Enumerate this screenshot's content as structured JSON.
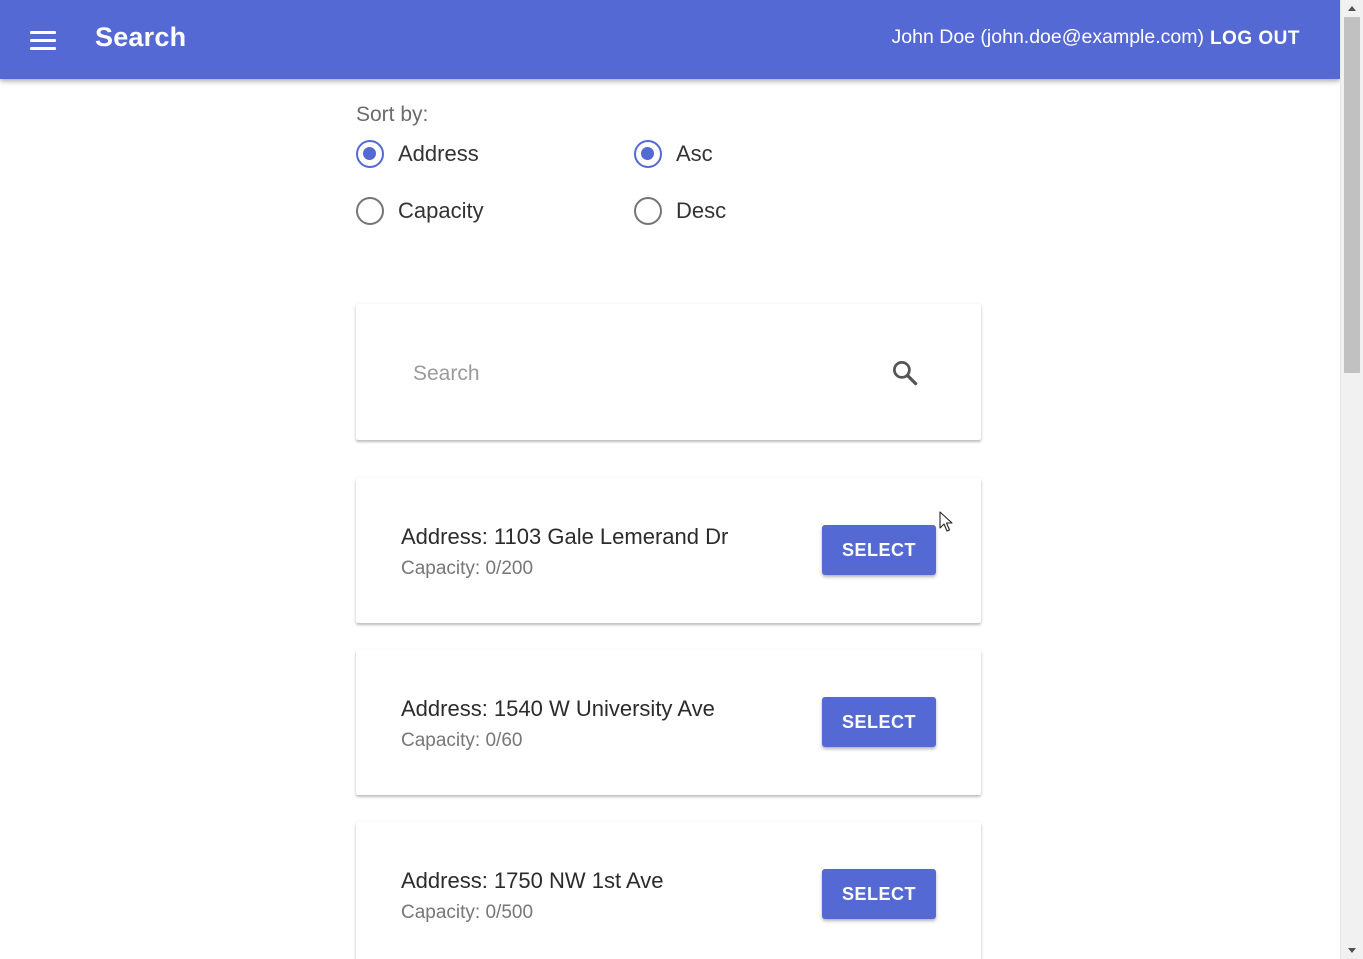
{
  "header": {
    "title": "Search",
    "user": "John Doe (john.doe@example.com)",
    "logout_label": "LOG OUT",
    "menu_icon": "hamburger-menu-icon"
  },
  "sort": {
    "label": "Sort by:",
    "field_options": [
      {
        "label": "Address",
        "checked": true
      },
      {
        "label": "Capacity",
        "checked": false
      }
    ],
    "order_options": [
      {
        "label": "Asc",
        "checked": true
      },
      {
        "label": "Desc",
        "checked": false
      }
    ]
  },
  "search": {
    "placeholder": "Search",
    "value": "",
    "icon": "magnifier-search-icon"
  },
  "results": [
    {
      "address": "Address: 1103 Gale Lemerand Dr",
      "capacity": "Capacity: 0/200",
      "button": "SELECT"
    },
    {
      "address": "Address: 1540 W University Ave",
      "capacity": "Capacity: 0/60",
      "button": "SELECT"
    },
    {
      "address": "Address: 1750 NW 1st Ave",
      "capacity": "Capacity: 0/500",
      "button": "SELECT"
    }
  ],
  "colors": {
    "primary": "#5469d4",
    "text": "#2b2b2b",
    "muted": "#777777"
  }
}
